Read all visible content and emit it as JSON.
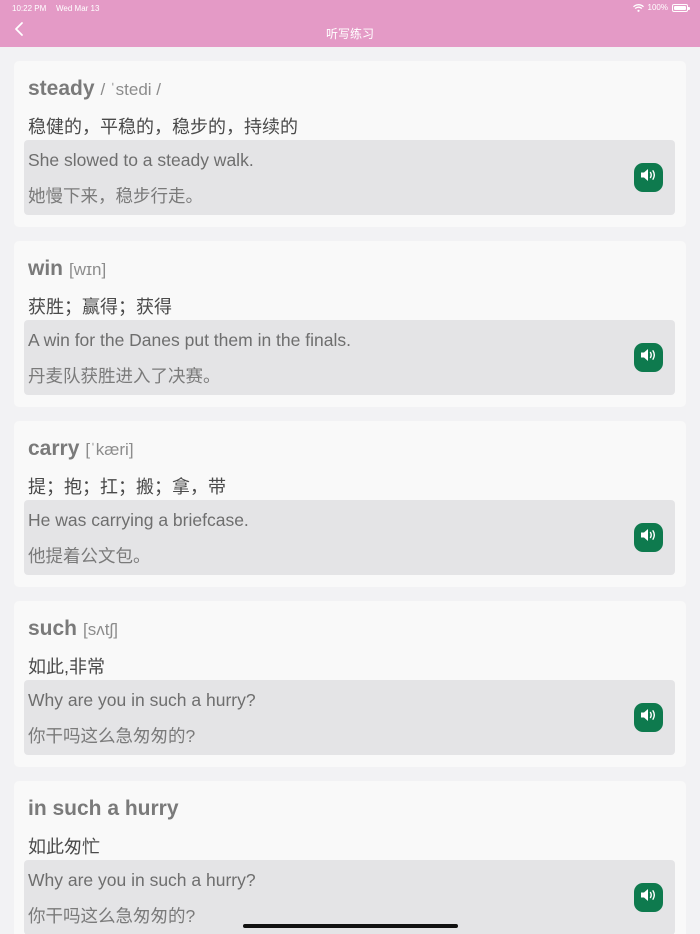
{
  "status_bar": {
    "time": "10:22 PM",
    "date": "Wed Mar 13",
    "battery": "100%"
  },
  "nav": {
    "title": "听写练习"
  },
  "cards": [
    {
      "word": "steady",
      "phonetic": "/ ˈstedi /",
      "meaning": "稳健的，平稳的，稳步的，持续的",
      "example_en": "She slowed to a steady walk.",
      "example_cn": "她慢下来，稳步行走。"
    },
    {
      "word": "win",
      "phonetic": "[wɪn]",
      "meaning": "获胜；赢得；获得",
      "example_en": "A win for the Danes put them in the finals.",
      "example_cn": "丹麦队获胜进入了决赛。"
    },
    {
      "word": "carry",
      "phonetic": "[ˈkæri]",
      "meaning": "提；抱；扛；搬；拿，带",
      "example_en": "He was carrying a briefcase.",
      "example_cn": "他提着公文包。"
    },
    {
      "word": "such",
      "phonetic": "[sʌtʃ]",
      "meaning": "如此,非常",
      "example_en": "Why are you in such a hurry?",
      "example_cn": "你干吗这么急匆匆的?"
    },
    {
      "word": "in such a hurry",
      "phonetic": "",
      "meaning": "如此匆忙",
      "example_en": "Why are you in such a hurry?",
      "example_cn": "你干吗这么急匆匆的?"
    }
  ],
  "icons": {
    "back": "chevron-left-icon",
    "speaker": "speaker-icon",
    "wifi": "wifi-icon",
    "battery": "battery-icon"
  },
  "colors": {
    "nav_background": "#e49ac6",
    "speaker_button": "#0e7a4e",
    "page_background": "#f2f2f4"
  }
}
